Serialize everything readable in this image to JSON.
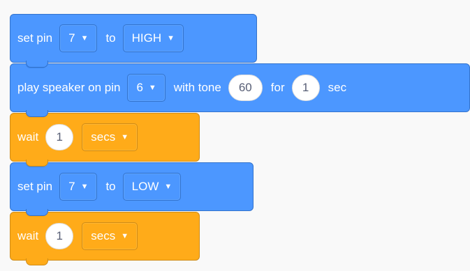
{
  "blocks": [
    {
      "type": "set_pin",
      "label": "set pin",
      "pin": "7",
      "to_label": "to",
      "value": "HIGH",
      "color": "#4c97ff"
    },
    {
      "type": "play_speaker",
      "label": "play speaker on pin",
      "pin": "6",
      "tone_label": "with tone",
      "tone": "60",
      "for_label": "for",
      "duration": "1",
      "unit": "sec",
      "color": "#4c97ff"
    },
    {
      "type": "wait",
      "label": "wait",
      "amount": "1",
      "unit": "secs",
      "color": "#ffab19"
    },
    {
      "type": "set_pin",
      "label": "set pin",
      "pin": "7",
      "to_label": "to",
      "value": "LOW",
      "color": "#4c97ff"
    },
    {
      "type": "wait",
      "label": "wait",
      "amount": "1",
      "unit": "secs",
      "color": "#ffab19"
    }
  ],
  "icons": {
    "dropdown_caret": "chevron-down-icon"
  }
}
